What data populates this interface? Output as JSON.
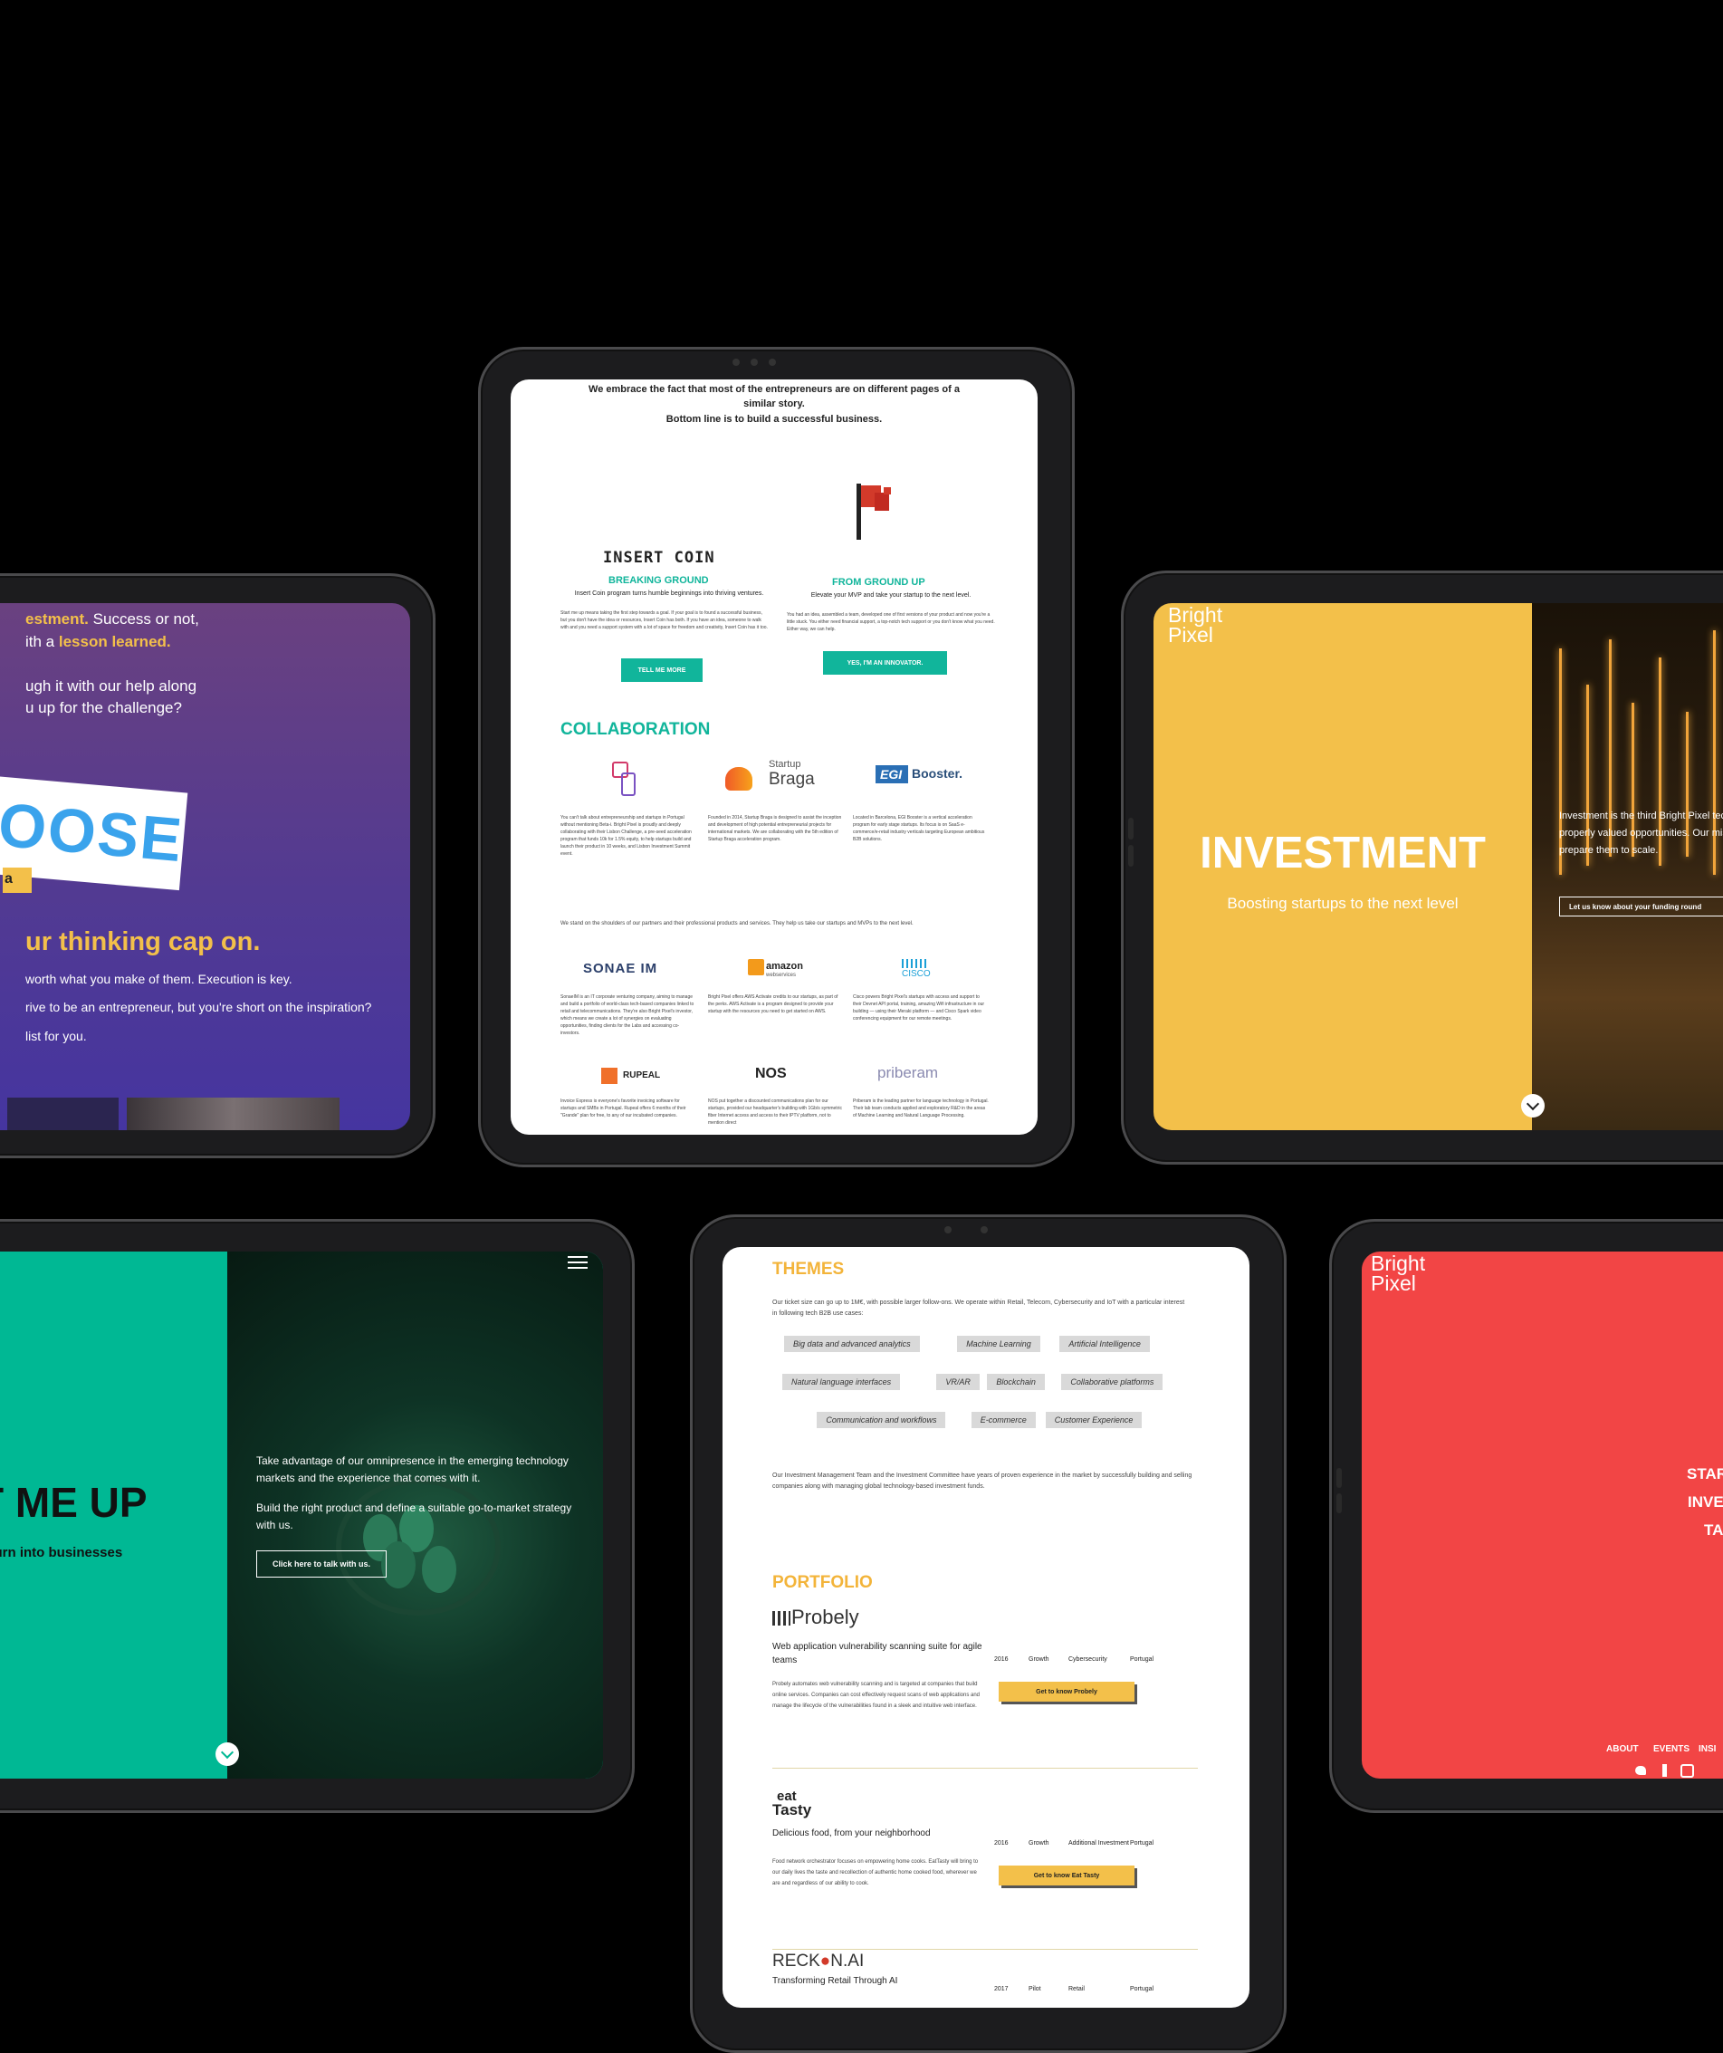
{
  "t1": {
    "line1_a": "estment.",
    "line1_b": " Success or not,",
    "line2_a": "ith a ",
    "line2_b": "lesson learned.",
    "line3": "ugh it with our help along",
    "line4": "u up for the challenge?",
    "choose_word": "OOSE",
    "choose_tag": "a",
    "cap_line": "ur thinking cap on.",
    "body1": "worth what you make of them. Execution is key.",
    "body2": "rive to be an entrepreneur, but you're short on the inspiration?",
    "body3": "list for you."
  },
  "t2": {
    "intro_line1": "We embrace the fact that most of the entrepreneurs are on different pages of a",
    "intro_line2": "similar story.",
    "intro_line3": "Bottom line is to build a successful business.",
    "insert_coin": "INSERT COIN",
    "breaking_ground": "BREAKING GROUND",
    "insert_sub": "Insert Coin program turns humble beginnings into thriving ventures.",
    "insert_body": "Start me up means taking the first step towards a goal. If your goal is to found a successful business, but you don't have the idea or resources, Insert Coin has both. If you have an idea, someone to walk with and you need a support system with a lot of space for freedom and creativity, Insert Coin has it too.",
    "tell_me_more": "TELL ME MORE",
    "from_ground_up": "FROM GROUND UP",
    "fgu_sub": "Elevate your MVP and take your startup to the next level.",
    "fgu_body": "You had an idea, assembled a team, developed one of first versions of your product and now you're a little stuck. You either need financial support, a top-notch tech support or you don't know what you need. Either way, we can help.",
    "innovator_btn": "YES, I'M AN INNOVATOR.",
    "collaboration": "COLLABORATION",
    "startup_braga_a": "Startup",
    "startup_braga_b": "Braga",
    "egi": "EGI",
    "booster": "Booster.",
    "collab1": "You can't talk about entrepreneurship and startups in Portugal without mentioning Beta-i. Bright Pixel is proudly and deeply collaborating with their Lisbon Challenge, a pre-seed acceleration program that funds 10k for 1.5% equity, to help startups build and launch their product in 10 weeks, and Lisbon Investment Summit event.",
    "collab2": "Founded in 2014, Startup Braga is designed to assist the inception and development of high potential entrepreneurial projects for international markets. We are collaborating with the 5th edition of Startup Braga acceleration program.",
    "collab3": "Located in Barcelona, EGI Booster is a vertical acceleration program for early stage startups. Its focus is on SaaS e-commerce/e-retail industry verticals targeting European ambitious B2B solutions.",
    "partners_intro": "We stand on the shoulders of our partners and their professional products and services. They help us take our startups and MVPs to the next level.",
    "sonaeim": "SONAE IM",
    "amazon_a": "amazon",
    "amazon_b": "webservices",
    "cisco": "CISCO",
    "partner1": "SonaeIM is an IT corporate venturing company, aiming to manage and build a portfolio of world-class tech-based companies linked to retail and telecommunications. They're also Bright Pixel's investor, which means we create a lot of synergies on evaluating opportunities, finding clients for the Labs and accessing co-investors.",
    "partner2": "Bright Pixel offers AWS Activate credits to our startups, as part of the perks. AWS Activate is a program designed to provide your startup with the resources you need to get started on AWS.",
    "partner3": "Cisco powers Bright Pixel's startups with access and support to their Devnet API portal, training, amazing Wifi infrastructure in our building — using their Meraki platform — and Cisco Spark video conferencing equipment for our remote meetings.",
    "rupeal": "RUPEAL",
    "nos": "NOS",
    "priberam": "priberam",
    "partner4": "Invoice Express is everyone's favorite invoicing software for startups and SMBs in Portugal. Rupeal offers 6 months of their \"Grande\" plan for free, to any of our incubated companies.",
    "partner5": "NOS put together a discounted communications plan for our startups, provided our headquarter's building with 1Gb/s symmetric fiber Internet access and access to their IPTV platform, not to mention direct",
    "partner6": "Priberam is the leading partner for language technology in Portugal. Their lab team conducts applied and exploratory R&D in the areas of Machine Learning and Natural Language Processing."
  },
  "t3": {
    "logo_line1": "Bright",
    "logo_line2": "Pixel",
    "title": "INVESTMENT",
    "subtitle": "Boosting startups to the next level",
    "side_text": "Investment is the third Bright Pixel tech expertise and properly valued opportunities. Our mission is to and prepare them to scale.",
    "side_button": "Let us know about your funding round"
  },
  "t4": {
    "title": "T ME UP",
    "subtitle": "s turn into businesses",
    "para1": "Take advantage of our omnipresence in the emerging technology markets and the experience that comes with it.",
    "para2": "Build the right product and define a suitable go-to-market strategy with us.",
    "button": "Click here to talk with us."
  },
  "t5": {
    "themes_title": "THEMES",
    "themes_intro": "Our ticket size can go up to 1M€, with possible larger follow-ons. We operate within Retail, Telecom, Cybersecurity and IoT with a particular interest in following tech B2B use cases:",
    "tags_row1": [
      "Big data and advanced analytics",
      "Machine Learning",
      "Artificial Intelligence"
    ],
    "tags_row2": [
      "Natural language interfaces",
      "VR/AR",
      "Blockchain",
      "Collaborative platforms"
    ],
    "tags_row3": [
      "Communication and workflows",
      "E-commerce",
      "Customer Experience"
    ],
    "team_text": "Our Investment Management Team and the Investment Committee have years of proven experience in the market by successfully building and selling companies along with managing global technology-based investment funds.",
    "portfolio_title": "PORTFOLIO",
    "probely_logo": "Probely",
    "probely_tagline": "Web application vulnerability scanning suite for agile teams",
    "probely_body": "Probely automates web vulnerability scanning and is targeted at companies that build online services. Companies can cost effectively request scans of web applications and manage the lifecycle of the vulnerabilities found in a sleek and intuitive web interface.",
    "probely_meta": [
      "2016",
      "Growth",
      "Cybersecurity",
      "Portugal"
    ],
    "probely_btn": "Get to know Probely",
    "eat_logo_a": "eat",
    "eat_logo_b": "Tasty",
    "eat_tagline": "Delicious food, from your neighborhood",
    "eat_body": "Food network orchestrator focuses on empowering home cooks. EatTasty will bring to our daily lives the taste and recollection of authentic home cooked food, wherever we are and regardless of our ability to cook.",
    "eat_meta": [
      "2016",
      "Growth",
      "Additional Investment",
      "Portugal"
    ],
    "eat_btn": "Get to know Eat Tasty",
    "reckon_a": "RECK",
    "reckon_b": "N.AI",
    "reckon_tagline": "Transforming Retail Through AI",
    "reckon_meta": [
      "2017",
      "Pilot",
      "Retail",
      "Portugal"
    ]
  },
  "t6": {
    "logo_line1": "Bright",
    "logo_line2": "Pixel",
    "menu_items": [
      "STAR",
      "INVE",
      "TA"
    ],
    "footer_nav": [
      "ABOUT",
      "EVENTS",
      "INSI"
    ]
  },
  "colors": {
    "purple_top": "#6a4180",
    "purple_bottom": "#4535a0",
    "yellow": "#f3c04a",
    "teal": "#00b894",
    "red": "#f24545",
    "accent_teal": "#11b59b",
    "accent_orange": "#f3b43a"
  }
}
